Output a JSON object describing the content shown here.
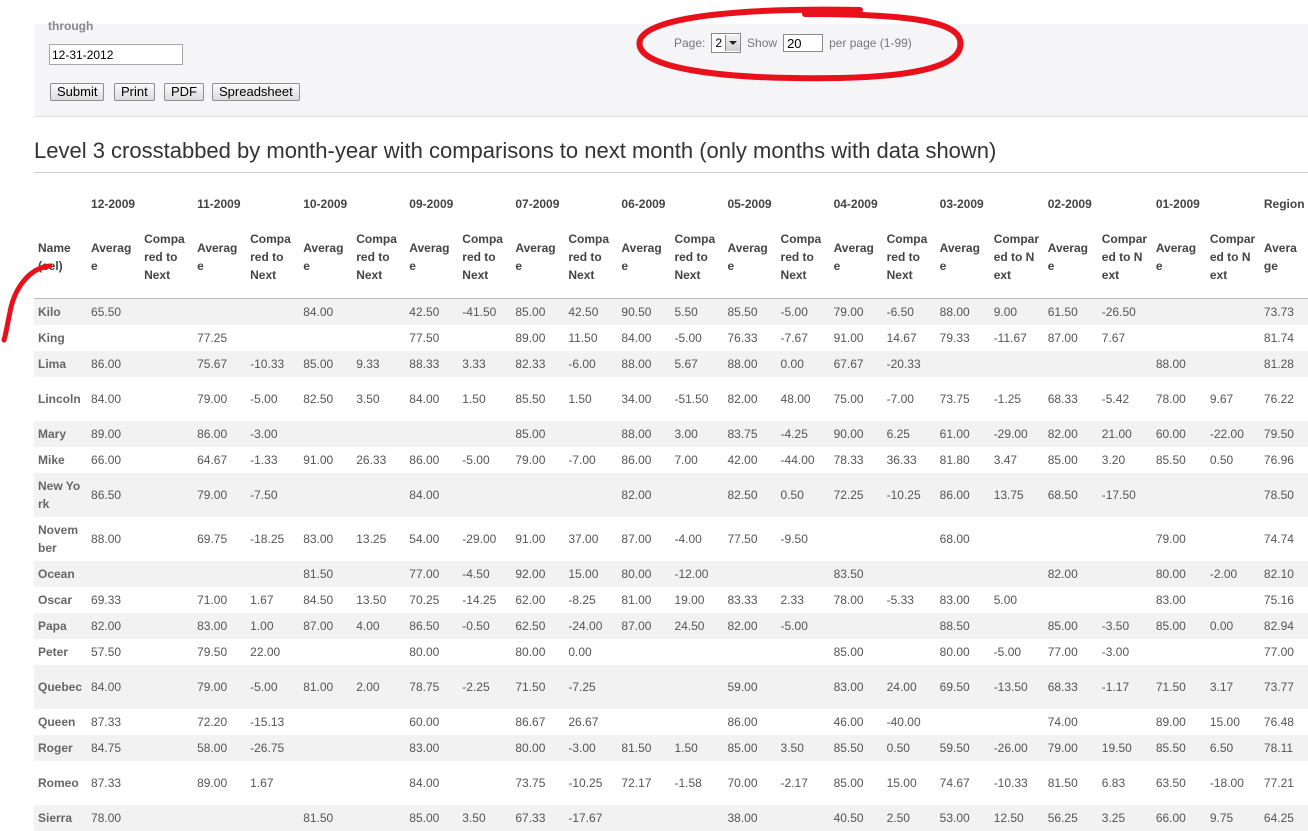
{
  "form": {
    "through_label": "through",
    "end_date_value": "12-31-2012",
    "buttons": {
      "submit": "Submit",
      "print": "Print",
      "pdf": "PDF",
      "spreadsheet": "Spreadsheet"
    }
  },
  "pager": {
    "page_label": "Page:",
    "page_value": "2",
    "show_label": "Show",
    "show_value": "20",
    "per_page_label": "per page (1-99)"
  },
  "report": {
    "title": "Level 3 crosstabbed by month-year with comparisons to next month (only months with data shown)"
  },
  "table": {
    "name_header": "Name (sel)",
    "average_label": "Average",
    "compared_label": "Compared to Next",
    "region_label": "Region",
    "months": [
      "12-2009",
      "11-2009",
      "10-2009",
      "09-2009",
      "07-2009",
      "06-2009",
      "05-2009",
      "04-2009",
      "03-2009",
      "02-2009",
      "01-2009"
    ],
    "rows": [
      {
        "name": "Kilo",
        "cells": [
          "65.50",
          "",
          "",
          "",
          "84.00",
          "",
          "42.50",
          "-41.50",
          "85.00",
          "42.50",
          "90.50",
          "5.50",
          "85.50",
          "-5.00",
          "79.00",
          "-6.50",
          "88.00",
          "9.00",
          "61.50",
          "-26.50",
          "",
          ""
        ],
        "region": "73.73"
      },
      {
        "name": "King",
        "cells": [
          "",
          "",
          "77.25",
          "",
          "",
          "",
          "77.50",
          "",
          "89.00",
          "11.50",
          "84.00",
          "-5.00",
          "76.33",
          "-7.67",
          "91.00",
          "14.67",
          "79.33",
          "-11.67",
          "87.00",
          "7.67",
          "",
          ""
        ],
        "region": "81.74"
      },
      {
        "name": "Lima",
        "cells": [
          "86.00",
          "",
          "75.67",
          "-10.33",
          "85.00",
          "9.33",
          "88.33",
          "3.33",
          "82.33",
          "-6.00",
          "88.00",
          "5.67",
          "88.00",
          "0.00",
          "67.67",
          "-20.33",
          "",
          "",
          "",
          "",
          "88.00",
          ""
        ],
        "region": "81.28"
      },
      {
        "name": "Lincoln",
        "cells": [
          "84.00",
          "",
          "79.00",
          "-5.00",
          "82.50",
          "3.50",
          "84.00",
          "1.50",
          "85.50",
          "1.50",
          "34.00",
          "-51.50",
          "82.00",
          "48.00",
          "75.00",
          "-7.00",
          "73.75",
          "-1.25",
          "68.33",
          "-5.42",
          "78.00",
          "9.67"
        ],
        "region": "76.22"
      },
      {
        "name": "Mary",
        "cells": [
          "89.00",
          "",
          "86.00",
          "-3.00",
          "",
          "",
          "",
          "",
          "85.00",
          "",
          "88.00",
          "3.00",
          "83.75",
          "-4.25",
          "90.00",
          "6.25",
          "61.00",
          "-29.00",
          "82.00",
          "21.00",
          "60.00",
          "-22.00"
        ],
        "region": "79.50"
      },
      {
        "name": "Mike",
        "cells": [
          "66.00",
          "",
          "64.67",
          "-1.33",
          "91.00",
          "26.33",
          "86.00",
          "-5.00",
          "79.00",
          "-7.00",
          "86.00",
          "7.00",
          "42.00",
          "-44.00",
          "78.33",
          "36.33",
          "81.80",
          "3.47",
          "85.00",
          "3.20",
          "85.50",
          "0.50"
        ],
        "region": "76.96"
      },
      {
        "name": "New York",
        "cells": [
          "86.50",
          "",
          "79.00",
          "-7.50",
          "",
          "",
          "84.00",
          "",
          "",
          "",
          "82.00",
          "",
          "82.50",
          "0.50",
          "72.25",
          "-10.25",
          "86.00",
          "13.75",
          "68.50",
          "-17.50",
          "",
          ""
        ],
        "region": "78.50"
      },
      {
        "name": "November",
        "cells": [
          "88.00",
          "",
          "69.75",
          "-18.25",
          "83.00",
          "13.25",
          "54.00",
          "-29.00",
          "91.00",
          "37.00",
          "87.00",
          "-4.00",
          "77.50",
          "-9.50",
          "",
          "",
          "68.00",
          "",
          "",
          "",
          "79.00",
          ""
        ],
        "region": "74.74"
      },
      {
        "name": "Ocean",
        "cells": [
          "",
          "",
          "",
          "",
          "81.50",
          "",
          "77.00",
          "-4.50",
          "92.00",
          "15.00",
          "80.00",
          "-12.00",
          "",
          "",
          "83.50",
          "",
          "",
          "",
          "82.00",
          "",
          "80.00",
          "-2.00"
        ],
        "region": "82.10"
      },
      {
        "name": "Oscar",
        "cells": [
          "69.33",
          "",
          "71.00",
          "1.67",
          "84.50",
          "13.50",
          "70.25",
          "-14.25",
          "62.00",
          "-8.25",
          "81.00",
          "19.00",
          "83.33",
          "2.33",
          "78.00",
          "-5.33",
          "83.00",
          "5.00",
          "",
          "",
          "83.00",
          ""
        ],
        "region": "75.16"
      },
      {
        "name": "Papa",
        "cells": [
          "82.00",
          "",
          "83.00",
          "1.00",
          "87.00",
          "4.00",
          "86.50",
          "-0.50",
          "62.50",
          "-24.00",
          "87.00",
          "24.50",
          "82.00",
          "-5.00",
          "",
          "",
          "88.50",
          "",
          "85.00",
          "-3.50",
          "85.00",
          "0.00"
        ],
        "region": "82.94"
      },
      {
        "name": "Peter",
        "cells": [
          "57.50",
          "",
          "79.50",
          "22.00",
          "",
          "",
          "80.00",
          "",
          "80.00",
          "0.00",
          "",
          "",
          "",
          "",
          "85.00",
          "",
          "80.00",
          "-5.00",
          "77.00",
          "-3.00",
          "",
          ""
        ],
        "region": "77.00"
      },
      {
        "name": "Quebec",
        "cells": [
          "84.00",
          "",
          "79.00",
          "-5.00",
          "81.00",
          "2.00",
          "78.75",
          "-2.25",
          "71.50",
          "-7.25",
          "",
          "",
          "59.00",
          "",
          "83.00",
          "24.00",
          "69.50",
          "-13.50",
          "68.33",
          "-1.17",
          "71.50",
          "3.17"
        ],
        "region": "73.77"
      },
      {
        "name": "Queen",
        "cells": [
          "87.33",
          "",
          "72.20",
          "-15.13",
          "",
          "",
          "60.00",
          "",
          "86.67",
          "26.67",
          "",
          "",
          "86.00",
          "",
          "46.00",
          "-40.00",
          "",
          "",
          "74.00",
          "",
          "89.00",
          "15.00"
        ],
        "region": "76.48"
      },
      {
        "name": "Roger",
        "cells": [
          "84.75",
          "",
          "58.00",
          "-26.75",
          "",
          "",
          "83.00",
          "",
          "80.00",
          "-3.00",
          "81.50",
          "1.50",
          "85.00",
          "3.50",
          "85.50",
          "0.50",
          "59.50",
          "-26.00",
          "79.00",
          "19.50",
          "85.50",
          "6.50"
        ],
        "region": "78.11"
      },
      {
        "name": "Romeo",
        "cells": [
          "87.33",
          "",
          "89.00",
          "1.67",
          "",
          "",
          "84.00",
          "",
          "73.75",
          "-10.25",
          "72.17",
          "-1.58",
          "70.00",
          "-2.17",
          "85.00",
          "15.00",
          "74.67",
          "-10.33",
          "81.50",
          "6.83",
          "63.50",
          "-18.00"
        ],
        "region": "77.21"
      },
      {
        "name": "Sierra",
        "cells": [
          "78.00",
          "",
          "",
          "",
          "81.50",
          "",
          "85.00",
          "3.50",
          "67.33",
          "-17.67",
          "",
          "",
          "38.00",
          "",
          "40.50",
          "2.50",
          "53.00",
          "12.50",
          "56.25",
          "3.25",
          "66.00",
          "9.75"
        ],
        "region": "64.25"
      }
    ]
  },
  "colors": {
    "annotation": "#e8101a",
    "stripe": "#f2f2f2"
  }
}
